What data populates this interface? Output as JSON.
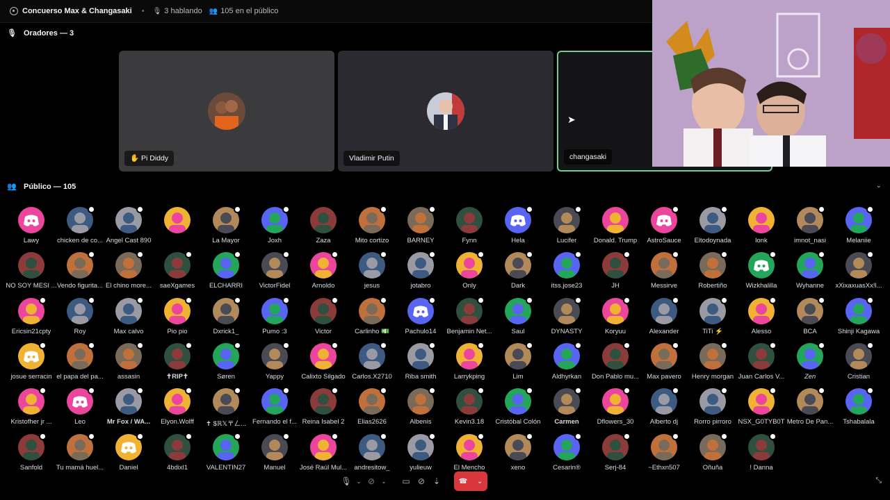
{
  "header": {
    "title": "Concuerso Max & Changasaki",
    "speaking": "3 hablando",
    "audience": "105 en el público"
  },
  "speakers_section": {
    "label": "Oradores — 3"
  },
  "speakers": [
    {
      "name": "Pi Diddy",
      "bg": "#3b3a3d"
    },
    {
      "name": "Vladimir Putin",
      "bg": "#2b2a30"
    },
    {
      "name": "changasaki",
      "bg": "#141316"
    }
  ],
  "audience_section": {
    "label": "Público — 105"
  },
  "members": [
    "Lawy",
    "chicken de co...",
    "Angel Cast 890",
    "",
    "La Mayor",
    "Joxh",
    "Zaza",
    "Mito cortizo",
    "BARNEY",
    "Fynn",
    "Hela",
    "Lucifer",
    "Donald. Trump",
    "AstroSauce",
    "Eltodoynada",
    "lonk",
    "imnot_nasi",
    "Melaniie",
    "NO SOY MESI ...",
    "Vendo figurita...",
    "El chino more...",
    "saeXgames",
    "ELCHARRI",
    "VictorFidel",
    "Arnoldo",
    "jesus",
    "jotabro",
    "Only",
    "Dark",
    "itss.jose23",
    "JH",
    "Messirve",
    "Robertiño",
    "Wizkhalilla",
    "Wyhanne",
    "xXixaxuasXx!l...",
    "Ericsin21cpty",
    "Roy",
    "Max calvo",
    "Pio pio",
    "Dxrick1_",
    "Pumo :3",
    "Victor",
    "Carlinho 💵",
    "Pachulo14",
    "Benjamin Net...",
    "Saul",
    "DYNASTY",
    "Koryuu",
    "Alexander",
    "TiTi ⚡",
    "Alesso",
    "BCA",
    "Shinji Kagawa",
    "josue serracin",
    "el papa del pa...",
    "assasin",
    "✝RIP✝",
    "Søren",
    "Yappy",
    "Calixto Silgado",
    "Carlos.X2710",
    "Riba smith",
    "Larrykping",
    "Lim",
    "Aldhyrkan",
    "Don Pablo mu...",
    "Max pavero",
    "Henry morgan",
    "Juan Carlos V...",
    "Zen",
    "Cristian",
    "Kristofher jr ...",
    "Leo",
    "Mr Fox / WA...",
    "Elyon.Wolff",
    "✝ $ℝ𝕏〒ㄥ...",
    "Fernando el f...",
    "Reina Isabel 2",
    "Elias2626",
    "Albenis",
    "Kevin3.18",
    "Cristóbal Colón",
    "Carmen",
    "Dflowers_30",
    "Alberto dj",
    "Rorro pirroro",
    "NSX_G0TYB0T",
    "Metro De Pan...",
    "Tshabalala",
    "Sanfold",
    "Tu mamá huel...",
    "Daniel",
    "4bdixl1",
    "VALENTIN27",
    "Manuel",
    "José Raúl Mul...",
    "andresitow_",
    "yulieuw",
    "El Mencho",
    "xeno",
    "Cesarin®",
    "Serj-84",
    "~Ethxn507",
    "Oñuña",
    "! Danna"
  ],
  "colors": {
    "discord_pink": "#eb459e",
    "discord_blurple": "#5865f2",
    "discord_green": "#23a55a",
    "discord_orange": "#f0b232",
    "hangup_red": "#da373c",
    "speaking_outline": "#6fcf97"
  },
  "icons": {
    "stage": "stage-icon",
    "mic": "mic-icon",
    "audience": "audience-icon",
    "screen": "screen-share-icon",
    "activity": "activity-icon",
    "hangup": "phone-hangup-icon",
    "collapse": "collapse-icon"
  }
}
